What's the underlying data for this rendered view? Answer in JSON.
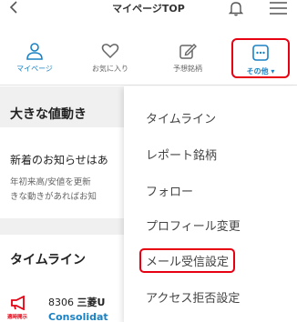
{
  "header": {
    "title": "マイページTOP"
  },
  "tabs": [
    {
      "label": "マイページ",
      "icon": "person-icon",
      "active": true
    },
    {
      "label": "お気に入り",
      "icon": "heart-icon",
      "active": false
    },
    {
      "label": "予想銘柄",
      "icon": "edit-icon",
      "active": false
    },
    {
      "label": "その他 ▾",
      "icon": "more-icon",
      "active": false
    }
  ],
  "sections": {
    "big_moves": {
      "title": "大きな値動き",
      "news_title": "新着のお知らせはあ",
      "news_body_line1": "年初来高/安値を更新",
      "news_body_line2": "きな動きがあればお知"
    },
    "timeline": {
      "title": "タイムライン",
      "item": {
        "badge": "適時開示",
        "code": "8306",
        "name": "三菱U",
        "link": "Consolidat"
      }
    }
  },
  "menu": {
    "items": [
      {
        "label": "タイムライン"
      },
      {
        "label": "レポート銘柄"
      },
      {
        "label": "フォロー"
      },
      {
        "label": "プロフィール変更"
      },
      {
        "label": "メール受信設定",
        "highlighted": true
      },
      {
        "label": "アクセス拒否設定"
      }
    ]
  },
  "colors": {
    "accent": "#1a82c4",
    "highlight_border": "#e60012",
    "section_bg": "#f0f0f0"
  }
}
